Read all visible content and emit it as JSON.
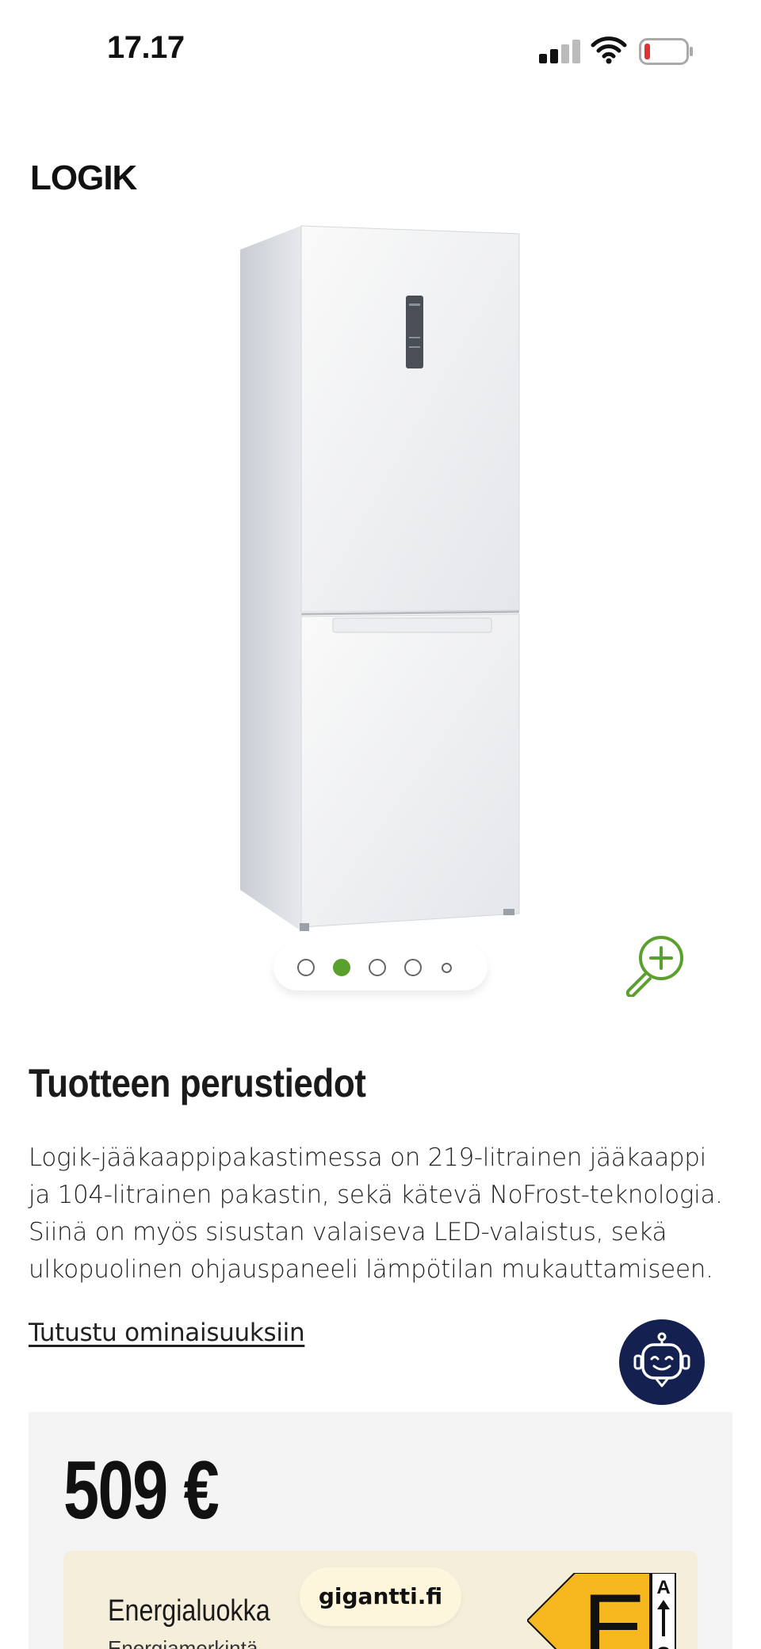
{
  "status_bar": {
    "time": "17.17"
  },
  "brand": {
    "logo_text": "LOGIK"
  },
  "carousel": {
    "slide_count": 5,
    "active_index": 1
  },
  "product": {
    "section_title": "Tuotteen perustiedot",
    "description": "Logik-jääkaappipakastimessa on 219-litrainen jääkaappi ja 104-litrainen pakastin, sekä kätevä NoFrost-teknologia. Siinä on myös sisustan valaiseva LED-valaistus, sekä ulkopuolinen ohjauspaneeli lämpötilan mukauttamiseen.",
    "features_link": "Tutustu ominaisuuksiin"
  },
  "price_card": {
    "price": "509 €",
    "energy_label": "Energialuokka",
    "energy_sub": "Energiamerkintä",
    "energy_class": "E",
    "scale_top": "A",
    "scale_bottom": "G"
  },
  "browser": {
    "url": "gigantti.fi"
  },
  "colors": {
    "accent_green": "#5aa02c",
    "chat_navy": "#14204f",
    "energy_yellow": "#f6b81e"
  },
  "icons": [
    "signal-icon",
    "wifi-icon",
    "battery-icon",
    "zoom-in-icon",
    "chatbot-icon",
    "energy-arrow-icon"
  ]
}
